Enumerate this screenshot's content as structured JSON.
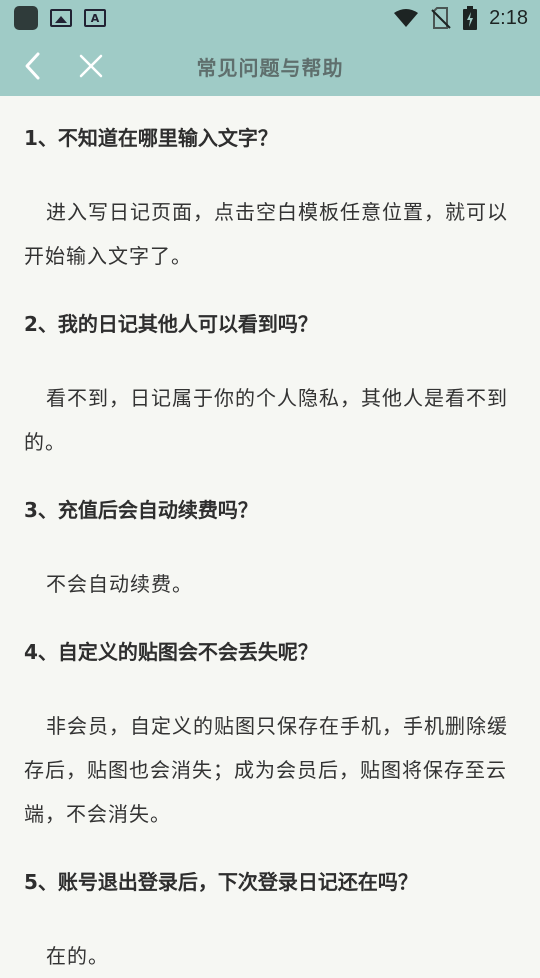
{
  "status_bar": {
    "time": "2:18",
    "icons": [
      "app-icon",
      "image-icon",
      "text-a-icon",
      "wifi-icon",
      "no-sim-icon",
      "battery-charging-icon"
    ]
  },
  "header": {
    "title": "常见问题与帮助",
    "back_icon": "chevron-left-icon",
    "close_icon": "close-icon",
    "background": "#9fcbc6"
  },
  "faqs": [
    {
      "question": "1、不知道在哪里输入文字？",
      "answer": "进入写日记页面，点击空白模板任意位置，就可以开始输入文字了。"
    },
    {
      "question": "2、我的日记其他人可以看到吗？",
      "answer": "看不到，日记属于你的个人隐私，其他人是看不到的。"
    },
    {
      "question": "3、充值后会自动续费吗？",
      "answer": "不会自动续费。"
    },
    {
      "question": "4、自定义的贴图会不会丢失呢？",
      "answer": "非会员，自定义的贴图只保存在手机，手机删除缓存后，贴图也会消失；成为会员后，贴图将保存至云端，不会消失。"
    },
    {
      "question": "5、账号退出登录后，下次登录日记还在吗？",
      "answer": "在的。"
    }
  ]
}
